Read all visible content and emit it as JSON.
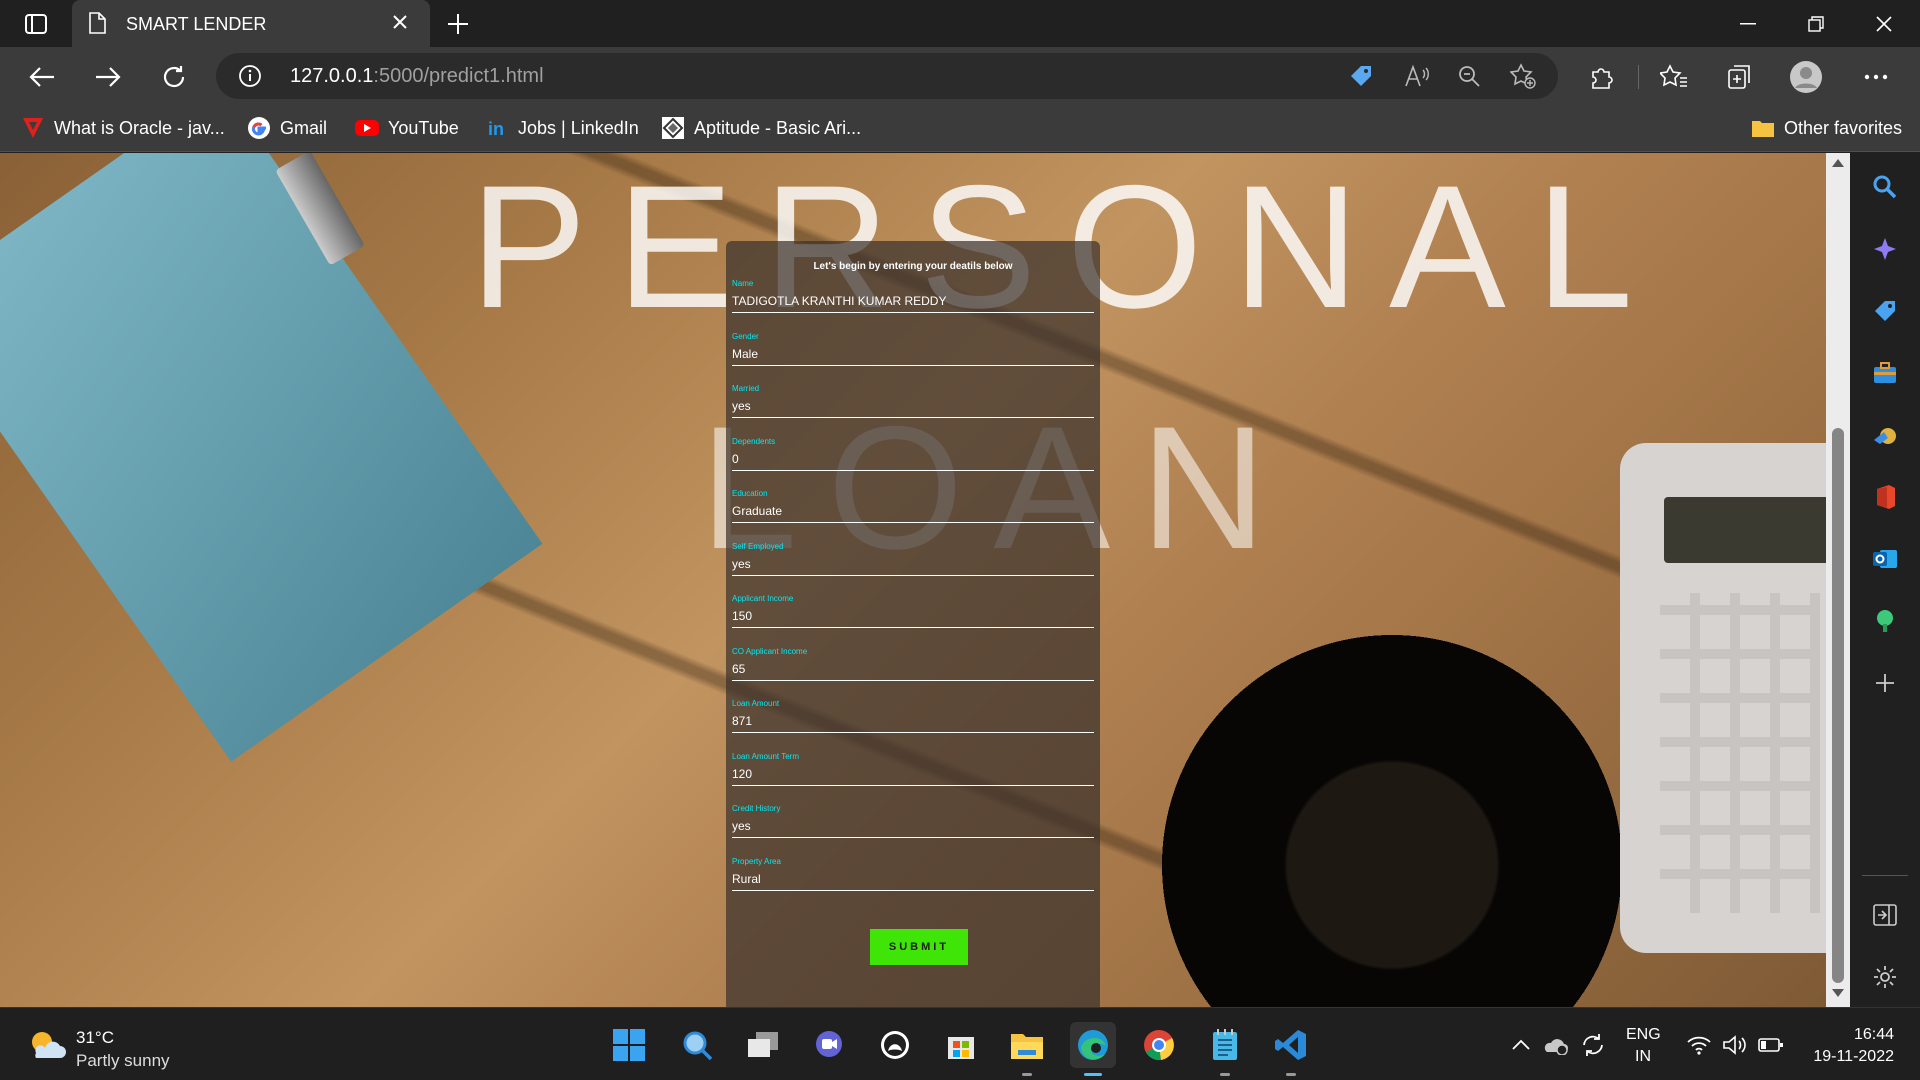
{
  "browser": {
    "tab_title": "SMART LENDER",
    "url_host": "127.0.0.1",
    "url_rest": ":5000/predict1.html",
    "bookmarks": [
      {
        "label": "What is Oracle - jav...",
        "icon": "oracle-icon"
      },
      {
        "label": "Gmail",
        "icon": "google-icon"
      },
      {
        "label": "YouTube",
        "icon": "youtube-icon"
      },
      {
        "label": "Jobs | LinkedIn",
        "icon": "linkedin-icon"
      },
      {
        "label": "Aptitude - Basic Ari...",
        "icon": "aptitude-icon"
      }
    ],
    "other_favorites": "Other favorites"
  },
  "page": {
    "hero_line1": "PERSONAL",
    "hero_line2": "LOAN",
    "form_heading": "Let's begin by entering your deatils below",
    "fields": [
      {
        "label": "Name",
        "value": "TADIGOTLA KRANTHI KUMAR REDDY"
      },
      {
        "label": "Gender",
        "value": "Male"
      },
      {
        "label": "Married",
        "value": "yes"
      },
      {
        "label": "Dependents",
        "value": "0"
      },
      {
        "label": "Education",
        "value": "Graduate"
      },
      {
        "label": "Self Employed",
        "value": "yes"
      },
      {
        "label": "Applicant Income",
        "value": "150"
      },
      {
        "label": "CO Applicant Income",
        "value": "65"
      },
      {
        "label": "Loan Amount",
        "value": "871"
      },
      {
        "label": "Loan Amount Term",
        "value": "120"
      },
      {
        "label": "Credit History",
        "value": "yes"
      },
      {
        "label": "Property Area",
        "value": "Rural"
      }
    ],
    "submit_label": "SUBMIT",
    "label_color": "#03e9f4",
    "submit_color": "#3fe507"
  },
  "taskbar": {
    "weather_temp": "31°C",
    "weather_desc": "Partly sunny",
    "lang_line1": "ENG",
    "lang_line2": "IN",
    "time": "16:44",
    "date": "19-11-2022"
  }
}
